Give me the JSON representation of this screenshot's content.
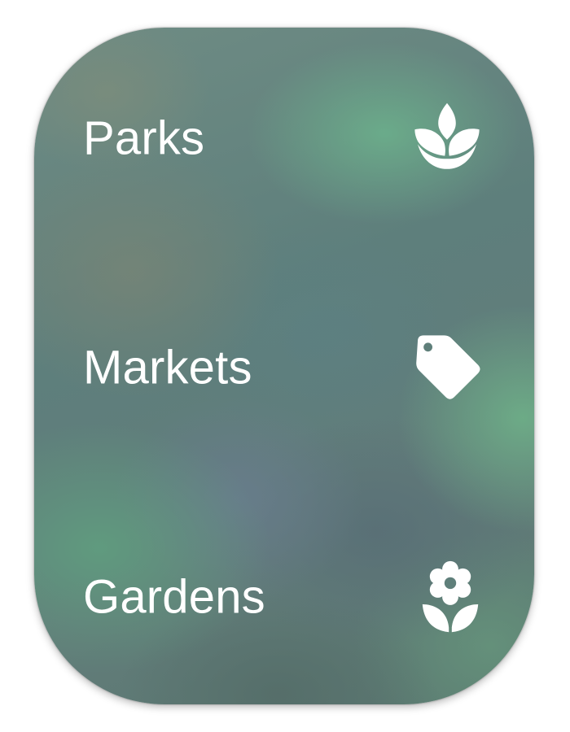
{
  "menu": {
    "items": [
      {
        "label": "Parks",
        "icon": "lotus-leaf-icon"
      },
      {
        "label": "Markets",
        "icon": "price-tag-icon"
      },
      {
        "label": "Gardens",
        "icon": "flower-icon"
      }
    ]
  },
  "colors": {
    "text": "#ffffff",
    "icon": "#ffffff",
    "background_accent": "#6cb28c"
  }
}
